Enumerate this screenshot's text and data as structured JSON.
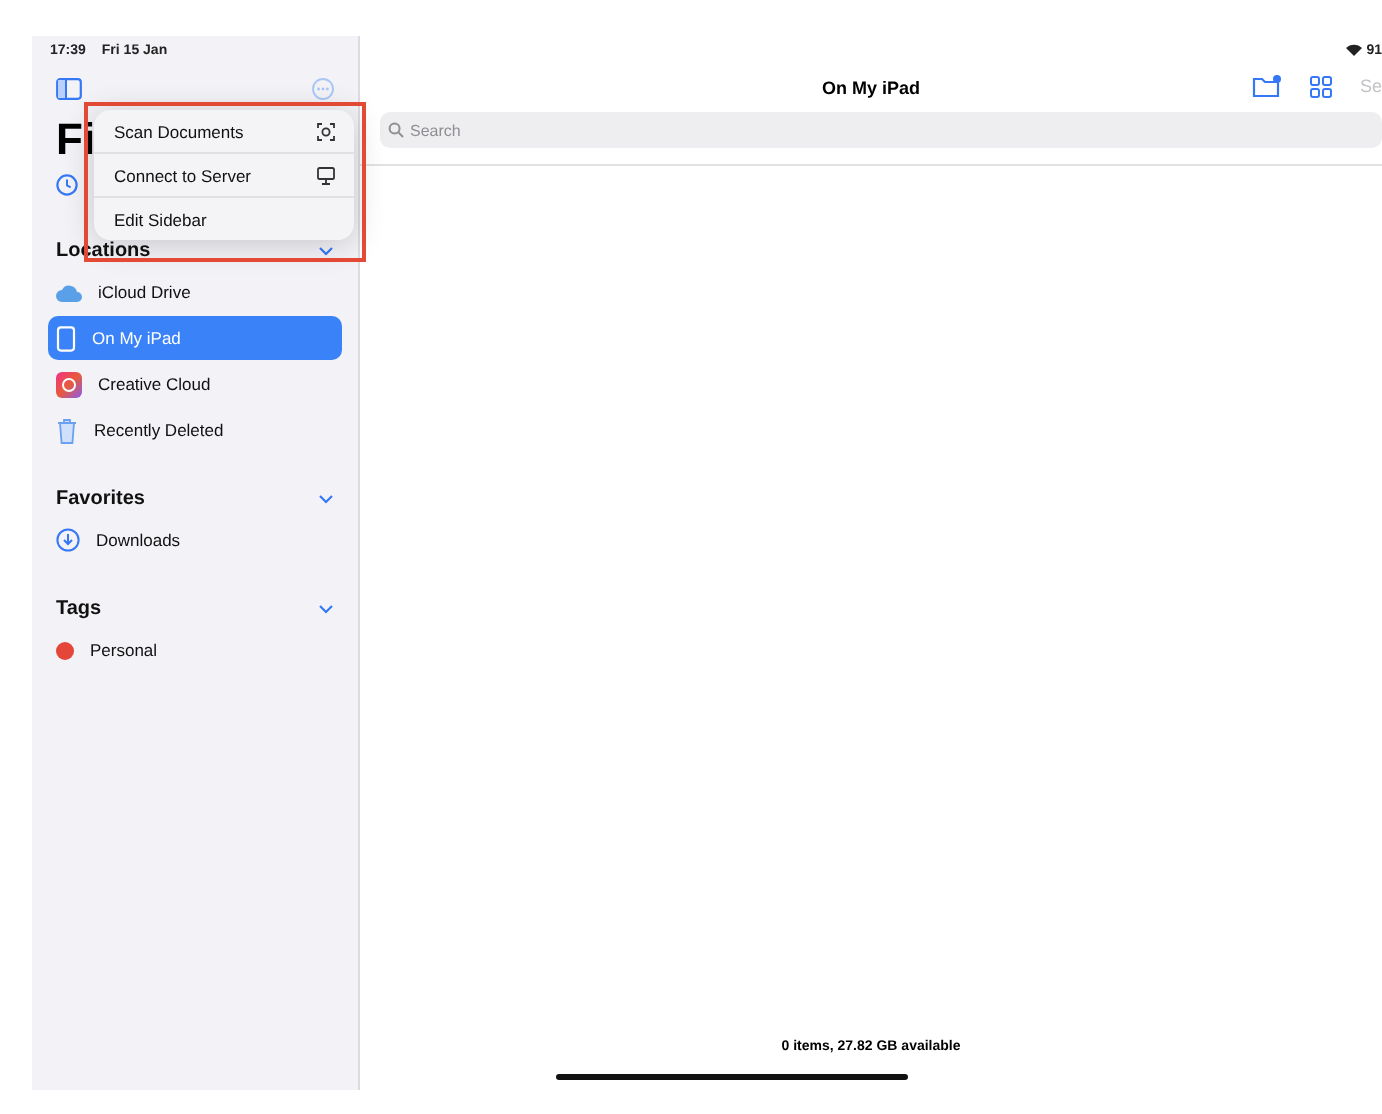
{
  "status_bar": {
    "time": "17:39",
    "date": "Fri 15 Jan",
    "battery": "91"
  },
  "sidebar": {
    "title": "Fi",
    "sections": [
      {
        "heading": "Locations",
        "expanded": true,
        "items": [
          {
            "label": "iCloud Drive",
            "kind": "cloud",
            "selected": false
          },
          {
            "label": "On My iPad",
            "kind": "ipad",
            "selected": true
          },
          {
            "label": "Creative Cloud",
            "kind": "creative",
            "selected": false
          },
          {
            "label": "Recently Deleted",
            "kind": "trash",
            "selected": false
          }
        ]
      },
      {
        "heading": "Favorites",
        "expanded": true,
        "items": [
          {
            "label": "Downloads",
            "kind": "download",
            "selected": false
          }
        ]
      },
      {
        "heading": "Tags",
        "expanded": true,
        "items": [
          {
            "label": "Personal",
            "kind": "tag",
            "color": "#e5463a",
            "selected": false
          }
        ]
      }
    ]
  },
  "menu": {
    "items": [
      {
        "label": "Scan Documents",
        "kind": "scan"
      },
      {
        "label": "Connect to Server",
        "kind": "server"
      },
      {
        "label": "Edit Sidebar",
        "kind": "plain"
      }
    ]
  },
  "main": {
    "title": "On My iPad",
    "select_button": "Se",
    "search": {
      "placeholder": "Search"
    },
    "footer": "0 items, 27.82 GB available"
  }
}
